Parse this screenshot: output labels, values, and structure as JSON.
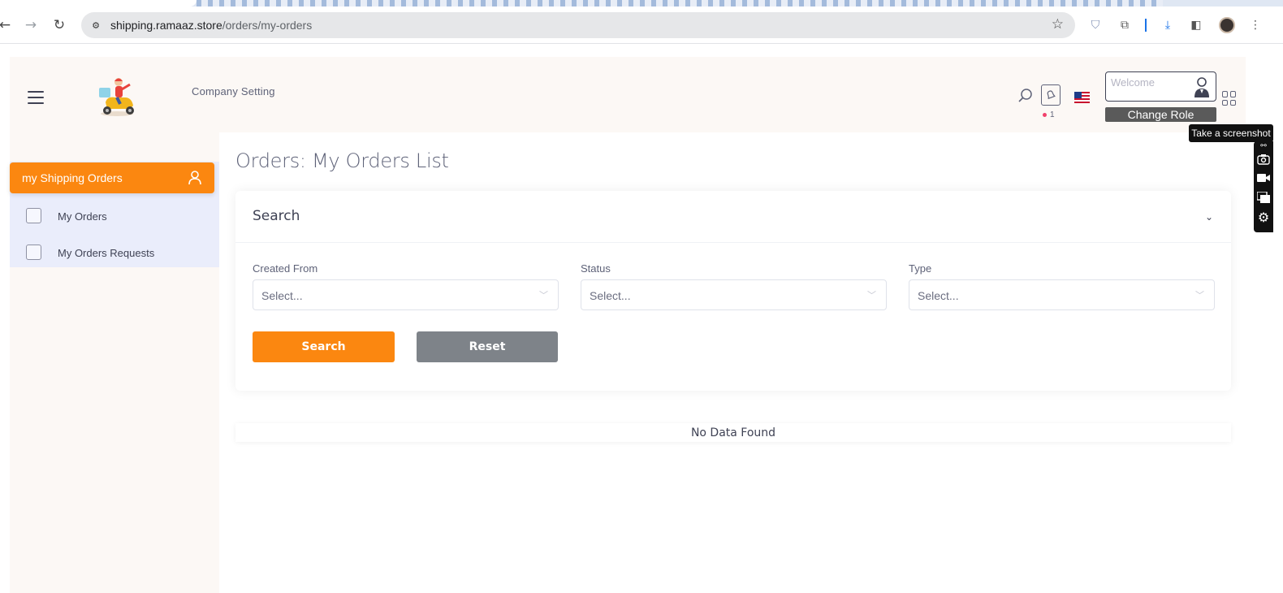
{
  "browser": {
    "url_host": "shipping.ramaaz.store",
    "url_path": "/orders/my-orders"
  },
  "header": {
    "company_setting": "Company Setting",
    "notification_count": "1",
    "welcome_placeholder": "Welcome",
    "change_role": "Change Role"
  },
  "sidebar": {
    "section_label": "my Shipping Orders",
    "items": [
      {
        "label": "My Orders"
      },
      {
        "label": "My Orders Requests"
      }
    ]
  },
  "main": {
    "title": "Orders: My Orders List",
    "search_card": {
      "title": "Search",
      "fields": [
        {
          "label": "Created From",
          "placeholder": "Select..."
        },
        {
          "label": "Status",
          "placeholder": "Select..."
        },
        {
          "label": "Type",
          "placeholder": "Select..."
        }
      ],
      "search_button": "Search",
      "reset_button": "Reset"
    },
    "empty_message": "No Data Found"
  },
  "extension": {
    "tooltip": "Take a screenshot"
  },
  "colors": {
    "accent": "#fb8710",
    "reset_button": "#7e8389",
    "sidebar_group": "#eaedfb",
    "header_bg": "#fcf8f5"
  }
}
